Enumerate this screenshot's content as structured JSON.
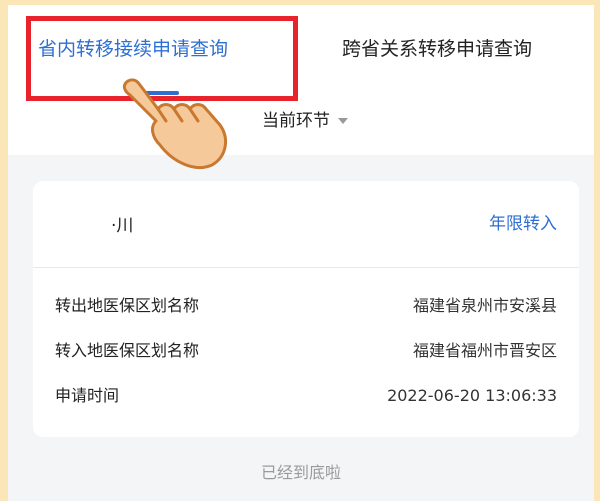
{
  "tabs": {
    "active": "省内转移接续申请查询",
    "inactive": "跨省关系转移申请查询"
  },
  "filter": {
    "label": "当前环节"
  },
  "record": {
    "person": "·川",
    "transfer_type": "年限转入",
    "fields": [
      {
        "label": "转出地医保区划名称",
        "value": "福建省泉州市安溪县"
      },
      {
        "label": "转入地医保区划名称",
        "value": "福建省福州市晋安区"
      },
      {
        "label": "申请时间",
        "value": "2022-06-20 13:06:33"
      }
    ]
  },
  "footer": {
    "end_text": "已经到底啦"
  },
  "colors": {
    "accent": "#2f6fd3",
    "highlight": "#e8232b",
    "backdrop": "#fbe6b8"
  }
}
